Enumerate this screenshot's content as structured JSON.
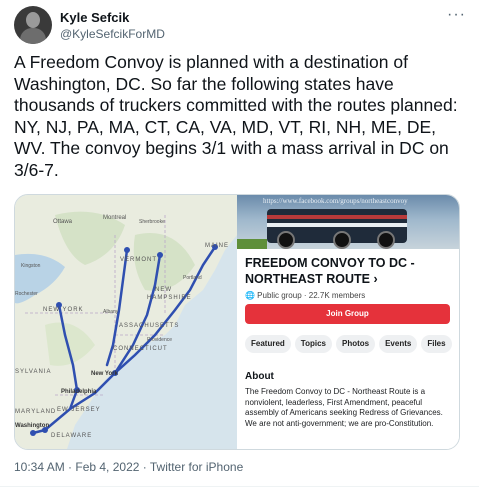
{
  "author": {
    "name": "Kyle Sefcik",
    "handle": "@KyleSefcikForMD"
  },
  "more_label": "···",
  "tweet": {
    "text": "A Freedom Convoy is planned with a destination of Washington, DC. So far the following states have thousands of truckers committed with the routes planned: NY, NJ, PA, MA, CT, CA, VA, MD, VT, RI, NH, ME, DE, WV. The convoy begins 3/1 with a mass arrival in DC on 3/6-7.",
    "timestamp": "10:34 AM · Feb 4, 2022 · Twitter for iPhone"
  },
  "map": {
    "labels": [
      "Ottawa",
      "Montreal",
      "Sherbrooke",
      "Kingston",
      "VERMONT",
      "Portland",
      "MAINE",
      "NEW HAMPSHIRE",
      "NEW YORK",
      "Albany",
      "MASSACHUSETTS",
      "Providence",
      "CONNECTICUT",
      "New York",
      "Philadelphia",
      "NEW JERSEY",
      "MARYLAND",
      "Washington",
      "DELAWARE",
      "PENNSYLVANIA",
      "Rochester"
    ],
    "route_color": "#2f4fb0"
  },
  "group": {
    "cover_url": "https://www.facebook.com/groups/northeastconvoy",
    "title": "FREEDOM CONVOY TO DC - NORTHEAST ROUTE ›",
    "meta": "🌐 Public group · 22.7K members",
    "join_label": "Join Group",
    "tabs": [
      "Featured",
      "Topics",
      "Photos",
      "Events",
      "Files"
    ],
    "about_heading": "About",
    "about_text": "The Freedom Convoy to DC - Northeast Route is a nonviolent, leaderless, First Amendment, peaceful assembly of Americans seeking Redress of Grievances. We are not anti-government; we are pro-Constitution.",
    "join_color": "#e5323b"
  }
}
